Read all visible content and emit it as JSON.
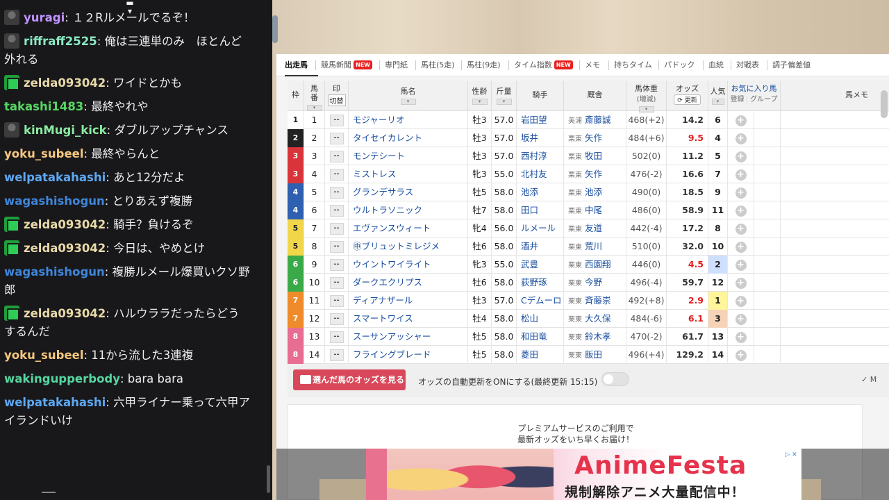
{
  "chat": {
    "messages": [
      {
        "badge": "avatar",
        "user": "yuragi",
        "color": "#bf94ff",
        "text": "１２Rルメールでるぞ！"
      },
      {
        "badge": "avatar",
        "user": "riffraff2525",
        "color": "#8be9c3",
        "text": "俺は三連単のみ　ほとんど外れる"
      },
      {
        "badge": "gift",
        "user": "zelda093042",
        "color": "#e8d9a8",
        "text": "ワイドとかも"
      },
      {
        "badge": "",
        "user": "takashi1483",
        "color": "#57d663",
        "text": "最終やれや"
      },
      {
        "badge": "avatar",
        "user": "kinMugi_kick",
        "color": "#8be9a0",
        "text": "ダブルアップチャンス"
      },
      {
        "badge": "",
        "user": "yoku_subeel",
        "color": "#f5c77e",
        "text": "最終やらんと"
      },
      {
        "badge": "",
        "user": "welpatakahashi",
        "color": "#5ea8f2",
        "text": "あと12分だよ"
      },
      {
        "badge": "",
        "user": "wagashishogun",
        "color": "#3f86d9",
        "text": "とりあえず複勝"
      },
      {
        "badge": "gift",
        "user": "zelda093042",
        "color": "#e8d9a8",
        "text": "騎手？負けるぞ"
      },
      {
        "badge": "gift",
        "user": "zelda093042",
        "color": "#e8d9a8",
        "text": "今日は、やめとけ"
      },
      {
        "badge": "",
        "user": "wagashishogun",
        "color": "#3f86d9",
        "text": "複勝ルメール爆買いクソ野郎"
      },
      {
        "badge": "gift",
        "user": "zelda093042",
        "color": "#e8d9a8",
        "text": "ハルウララだったらどうするんだ"
      },
      {
        "badge": "",
        "user": "yoku_subeel",
        "color": "#f5c77e",
        "text": "11から流した3連複"
      },
      {
        "badge": "",
        "user": "wakingupperbody",
        "color": "#57d6a0",
        "text": "bara bara"
      },
      {
        "badge": "",
        "user": "welpatakahashi",
        "color": "#5ea8f2",
        "text": "六甲ライナー乗って六甲アイランドいけ"
      }
    ]
  },
  "tabs": [
    {
      "label": "出走馬",
      "active": true,
      "new": false
    },
    {
      "label": "競馬新聞",
      "active": false,
      "new": true
    },
    {
      "label": "専門紙",
      "active": false,
      "new": false
    },
    {
      "label": "馬柱(5走)",
      "active": false,
      "new": false
    },
    {
      "label": "馬柱(9走)",
      "active": false,
      "new": false
    },
    {
      "label": "タイム指数",
      "active": false,
      "new": true
    },
    {
      "label": "メモ",
      "active": false,
      "new": false
    },
    {
      "label": "持ちタイム",
      "active": false,
      "new": false
    },
    {
      "label": "パドック",
      "active": false,
      "new": false
    },
    {
      "label": "血統",
      "active": false,
      "new": false
    },
    {
      "label": "対戦表",
      "active": false,
      "new": false
    },
    {
      "label": "調子偏差値",
      "active": false,
      "new": false
    }
  ],
  "new_badge": "NEW",
  "headers": {
    "waku": "枠",
    "umaban": "馬番",
    "mark": "印",
    "kirikae": "切替",
    "name": "馬名",
    "sexage": "性齢",
    "kinryo": "斤量",
    "jockey": "騎手",
    "trainer": "厩舎",
    "weight": "馬体重",
    "weight_sub": "(増減)",
    "odds": "オッズ",
    "update": "更新",
    "ninki": "人気",
    "fav": "お気に入り馬",
    "fav_reg": "登録",
    "fav_group": "グループ",
    "memo": "馬メモ"
  },
  "mark_placeholder": "--",
  "waku_colors": {
    "1": "#ffffff",
    "2": "#222222",
    "3": "#d8343a",
    "4": "#2f5fb0",
    "5": "#f2d64a",
    "6": "#3aaa48",
    "7": "#ef8b2a",
    "8": "#e86d93"
  },
  "horses": [
    {
      "waku": "1",
      "num": "1",
      "name": "モジャーリオ",
      "sexage": "牡3",
      "kinryo": "57.0",
      "jockey": "岩田望",
      "area": "美浦",
      "trainer": "斎藤誠",
      "weight": "468(+2)",
      "odds": "14.2",
      "ninki": "6",
      "odds_red": false,
      "ninki_bg": ""
    },
    {
      "waku": "2",
      "num": "2",
      "name": "タイセイカレント",
      "sexage": "牡3",
      "kinryo": "57.0",
      "jockey": "坂井",
      "area": "栗東",
      "trainer": "矢作",
      "weight": "484(+6)",
      "odds": "9.5",
      "ninki": "4",
      "odds_red": true,
      "ninki_bg": ""
    },
    {
      "waku": "3",
      "num": "3",
      "name": "モンテシート",
      "sexage": "牡3",
      "kinryo": "57.0",
      "jockey": "西村淳",
      "area": "栗東",
      "trainer": "牧田",
      "weight": "502(0)",
      "odds": "11.2",
      "ninki": "5",
      "odds_red": false,
      "ninki_bg": ""
    },
    {
      "waku": "3",
      "num": "4",
      "name": "ミストレス",
      "sexage": "牝3",
      "kinryo": "55.0",
      "jockey": "北村友",
      "area": "栗東",
      "trainer": "矢作",
      "weight": "476(-2)",
      "odds": "16.6",
      "ninki": "7",
      "odds_red": false,
      "ninki_bg": ""
    },
    {
      "waku": "4",
      "num": "5",
      "name": "グランデサラス",
      "sexage": "牡5",
      "kinryo": "58.0",
      "jockey": "池添",
      "area": "栗東",
      "trainer": "池添",
      "weight": "490(0)",
      "odds": "18.5",
      "ninki": "9",
      "odds_red": false,
      "ninki_bg": ""
    },
    {
      "waku": "4",
      "num": "6",
      "name": "ウルトラソニック",
      "sexage": "牡7",
      "kinryo": "58.0",
      "jockey": "田口",
      "area": "栗東",
      "trainer": "中尾",
      "weight": "486(0)",
      "odds": "58.9",
      "ninki": "11",
      "odds_red": false,
      "ninki_bg": ""
    },
    {
      "waku": "5",
      "num": "7",
      "name": "エヴァンスウィート",
      "sexage": "牝4",
      "kinryo": "56.0",
      "jockey": "ルメール",
      "area": "栗東",
      "trainer": "友道",
      "weight": "442(-4)",
      "odds": "17.2",
      "ninki": "8",
      "odds_red": false,
      "ninki_bg": ""
    },
    {
      "waku": "5",
      "num": "8",
      "name": "㊥ブリュットミレジメ",
      "sexage": "牡6",
      "kinryo": "58.0",
      "jockey": "酒井",
      "area": "栗東",
      "trainer": "荒川",
      "weight": "510(0)",
      "odds": "32.0",
      "ninki": "10",
      "odds_red": false,
      "ninki_bg": ""
    },
    {
      "waku": "6",
      "num": "9",
      "name": "ウイントワイライト",
      "sexage": "牝3",
      "kinryo": "55.0",
      "jockey": "武豊",
      "area": "栗東",
      "trainer": "西園翔",
      "weight": "446(0)",
      "odds": "4.5",
      "ninki": "2",
      "odds_red": true,
      "ninki_bg": "#cfe0ff"
    },
    {
      "waku": "6",
      "num": "10",
      "name": "ダークエクリプス",
      "sexage": "牡6",
      "kinryo": "58.0",
      "jockey": "荻野琢",
      "area": "栗東",
      "trainer": "今野",
      "weight": "496(-4)",
      "odds": "59.7",
      "ninki": "12",
      "odds_red": false,
      "ninki_bg": ""
    },
    {
      "waku": "7",
      "num": "11",
      "name": "ディアナザール",
      "sexage": "牡3",
      "kinryo": "57.0",
      "jockey": "Cデムーロ",
      "area": "栗東",
      "trainer": "斉藤崇",
      "weight": "492(+8)",
      "odds": "2.9",
      "ninki": "1",
      "odds_red": true,
      "ninki_bg": "#fff59a"
    },
    {
      "waku": "7",
      "num": "12",
      "name": "スマートワイス",
      "sexage": "牡4",
      "kinryo": "58.0",
      "jockey": "松山",
      "area": "栗東",
      "trainer": "大久保",
      "weight": "484(-6)",
      "odds": "6.1",
      "ninki": "3",
      "odds_red": true,
      "ninki_bg": "#f6d3b8"
    },
    {
      "waku": "8",
      "num": "13",
      "name": "スーサンアッシャー",
      "sexage": "牡5",
      "kinryo": "58.0",
      "jockey": "和田竜",
      "area": "栗東",
      "trainer": "鈴木孝",
      "weight": "470(-2)",
      "odds": "61.7",
      "ninki": "13",
      "odds_red": false,
      "ninki_bg": ""
    },
    {
      "waku": "8",
      "num": "14",
      "name": "フライングブレード",
      "sexage": "牡5",
      "kinryo": "58.0",
      "jockey": "菱田",
      "area": "栗東",
      "trainer": "飯田",
      "weight": "496(+4)",
      "odds": "129.2",
      "ninki": "14",
      "odds_red": false,
      "ninki_bg": ""
    }
  ],
  "odds_bar": {
    "button": "選んだ馬のオッズを見る",
    "auto_update": "オッズの自動更新をONにする(最終更新 15:15)",
    "right_label": "M"
  },
  "premium": {
    "line1": "プレミアムサービスのご利用で",
    "line2": "最新オッズをいち早くお届け！"
  },
  "ad": {
    "logo": "AnimeFesta",
    "sub": "規制解除アニメ大量配信中！",
    "close": "▷ ✕"
  }
}
